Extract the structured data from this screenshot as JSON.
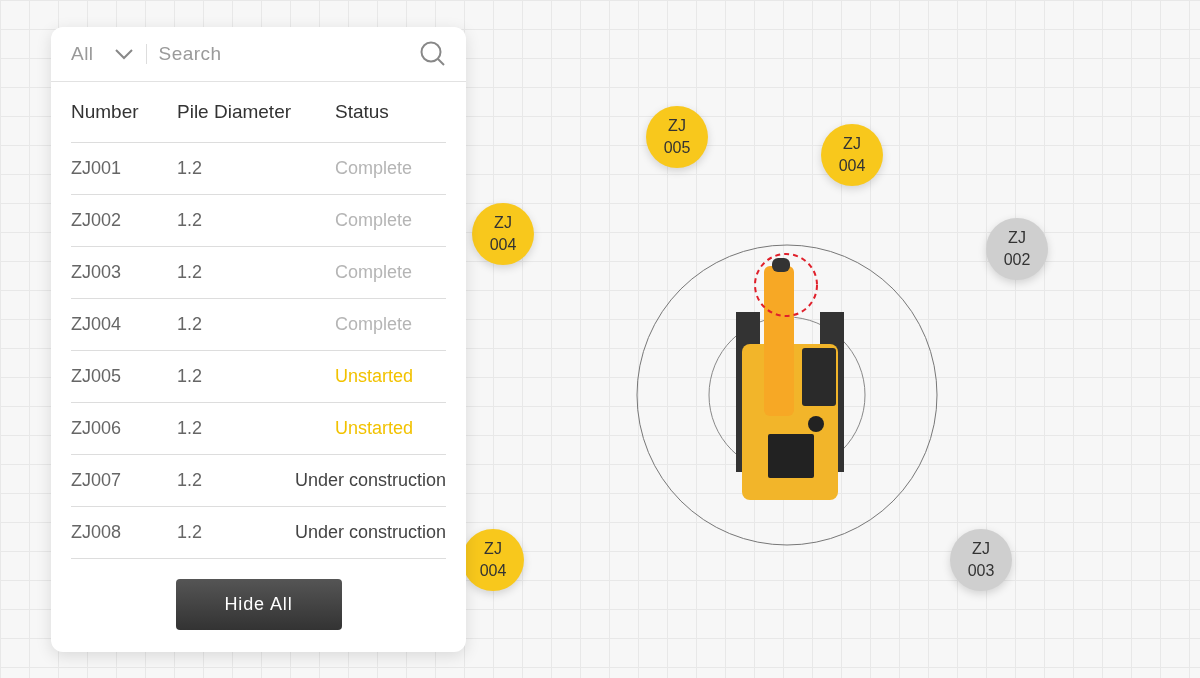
{
  "filter": {
    "value": "All"
  },
  "search": {
    "placeholder": "Search"
  },
  "table": {
    "columns": [
      "Number",
      "Pile Diameter",
      "Status"
    ],
    "rows": [
      {
        "number": "ZJ001",
        "diameter": "1.2",
        "status": "Complete",
        "kind": "complete"
      },
      {
        "number": "ZJ002",
        "diameter": "1.2",
        "status": "Complete",
        "kind": "complete"
      },
      {
        "number": "ZJ003",
        "diameter": "1.2",
        "status": "Complete",
        "kind": "complete"
      },
      {
        "number": "ZJ004",
        "diameter": "1.2",
        "status": "Complete",
        "kind": "complete"
      },
      {
        "number": "ZJ005",
        "diameter": "1.2",
        "status": "Unstarted",
        "kind": "unstarted"
      },
      {
        "number": "ZJ006",
        "diameter": "1.2",
        "status": "Unstarted",
        "kind": "unstarted"
      },
      {
        "number": "ZJ007",
        "diameter": "1.2",
        "status": "Under construction",
        "kind": "active"
      },
      {
        "number": "ZJ008",
        "diameter": "1.2",
        "status": "Under construction",
        "kind": "active"
      }
    ]
  },
  "hide_button": "Hide All",
  "piles": [
    {
      "label": "ZJ 005",
      "color": "#f8c81c"
    },
    {
      "label": "ZJ 004",
      "color": "#f8c81c"
    },
    {
      "label": "ZJ 004",
      "color": "#f8c81c"
    },
    {
      "label": "ZJ 002",
      "color": "#cfcfcf"
    },
    {
      "label": "ZJ 004",
      "color": "#f8c81c"
    },
    {
      "label": "ZJ 003",
      "color": "#cfcfcf"
    }
  ]
}
